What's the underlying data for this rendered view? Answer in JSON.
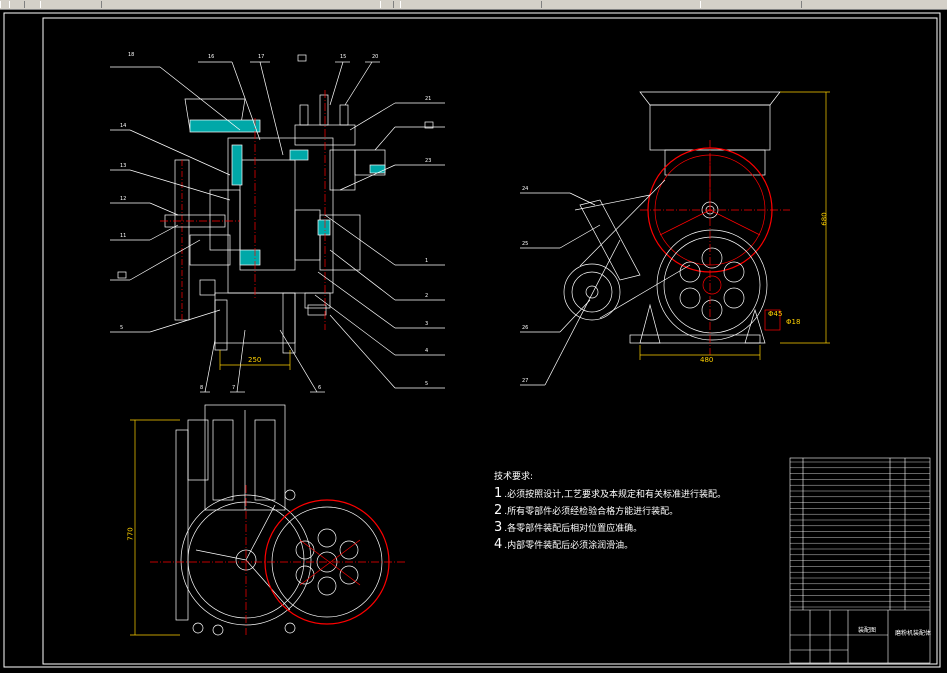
{
  "window": {
    "toolbar_color": "#d4d0c8"
  },
  "colors": {
    "background": "#000000",
    "lines": "#ffffff",
    "sections": "#ff0000",
    "hatch": "#00c8c8",
    "dimensions": "#ffd200"
  },
  "front_view": {
    "labels": [
      "18",
      "16",
      "17",
      "15",
      "20",
      "14",
      "21",
      "13",
      "23",
      "12",
      "11",
      "1",
      "2",
      "3",
      "4",
      "5",
      "6",
      "7",
      "8"
    ],
    "dimension": "250"
  },
  "side_view": {
    "labels": [
      "24",
      "25",
      "26",
      "27"
    ],
    "dimensions": {
      "height": "680",
      "width": "480",
      "small_a": "Φ45",
      "small_b": "Φ18"
    }
  },
  "plan_view": {
    "dimension": "770"
  },
  "technical_notes": {
    "heading": "技术要求:",
    "items": [
      {
        "num": "1",
        "text": ".必须按照设计,工艺要求及本规定和有关标准进行装配。"
      },
      {
        "num": "2",
        "text": ".所有零部件必须经检验合格方能进行装配。"
      },
      {
        "num": "3",
        "text": ".各零部件装配后相对位置应准确。"
      },
      {
        "num": "4",
        "text": ".内部零件装配后必须涂润滑油。"
      }
    ]
  },
  "title_block": {
    "drawing_type": "装配图",
    "drawing_name": "磨粉机装配体"
  }
}
